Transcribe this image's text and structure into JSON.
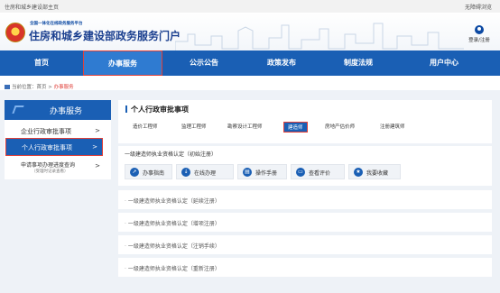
{
  "topbar": {
    "left_text": "住房和城乡建设部主页",
    "right_text": "无障碍浏览"
  },
  "header": {
    "subtitle": "全国一体化在线政务服务平台",
    "title": "住房和城乡建设部政务服务门户",
    "login_label": "登录/注册"
  },
  "nav": {
    "items": [
      {
        "label": "首页"
      },
      {
        "label": "办事服务"
      },
      {
        "label": "公示公告"
      },
      {
        "label": "政策发布"
      },
      {
        "label": "制度法规"
      },
      {
        "label": "用户中心"
      }
    ],
    "active": "办事服务"
  },
  "breadcrumb": {
    "prefix": "当前位置：",
    "home": "首页",
    "sep": " > ",
    "current": "办事服务"
  },
  "sidebar": {
    "header": "办事服务",
    "items": [
      {
        "label": "企业行政审批事项",
        "chev": ">"
      },
      {
        "label": "个人行政审批事项",
        "chev": ">"
      },
      {
        "label": "申请事项办理进度查询",
        "sub": "（受理时记录查看）",
        "chev": ">"
      }
    ]
  },
  "main": {
    "title": "个人行政审批事项",
    "tabs": [
      {
        "label": "造价工程师"
      },
      {
        "label": "监理工程师"
      },
      {
        "label": "勘察设计工程师"
      },
      {
        "label": "建造师"
      },
      {
        "label": "房地产估价师"
      },
      {
        "label": "注册建筑师"
      }
    ],
    "active_tab": "建造师",
    "card": {
      "title": "一级建造师执业资格认定（初始注册）",
      "buttons": [
        {
          "label": "办事指南",
          "icon": "guide-icon"
        },
        {
          "label": "在线办理",
          "icon": "online-icon"
        },
        {
          "label": "操作手册",
          "icon": "manual-icon"
        },
        {
          "label": "查看评价",
          "icon": "review-icon"
        },
        {
          "label": "我要收藏",
          "icon": "star-icon"
        }
      ]
    },
    "rows": [
      {
        "label": "一级建造师执业资格认定（延续注册）"
      },
      {
        "label": "一级建造师执业资格认定（增项注册）"
      },
      {
        "label": "一级建造师执业资格认定（注销手续）"
      },
      {
        "label": "一级建造师执业资格认定（重新注册）"
      }
    ]
  },
  "colors": {
    "primary": "#1a5fb4",
    "highlight": "#e0403a",
    "background": "#eef2f7"
  }
}
